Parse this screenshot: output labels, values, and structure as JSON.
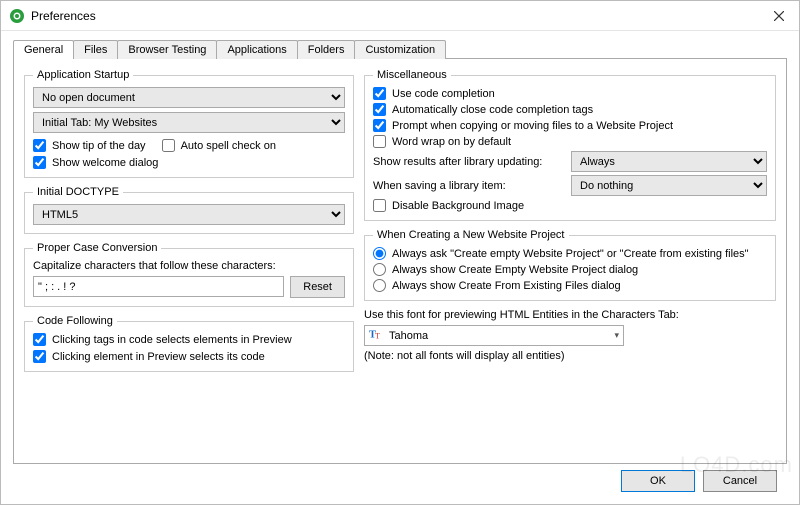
{
  "window": {
    "title": "Preferences"
  },
  "tabs": [
    "General",
    "Files",
    "Browser Testing",
    "Applications",
    "Folders",
    "Customization"
  ],
  "startup": {
    "legend": "Application Startup",
    "doc": "No open document",
    "initialTab": "Initial Tab: My Websites",
    "tip": "Show tip of the day",
    "spell": "Auto spell check on",
    "welcome": "Show welcome dialog"
  },
  "doctype": {
    "legend": "Initial DOCTYPE",
    "value": "HTML5"
  },
  "propercase": {
    "legend": "Proper Case Conversion",
    "label": "Capitalize characters that follow these characters:",
    "value": "\" ; : . ! ?",
    "reset": "Reset"
  },
  "codefollow": {
    "legend": "Code Following",
    "a": "Clicking tags in code selects elements in Preview",
    "b": "Clicking element in Preview selects its code"
  },
  "misc": {
    "legend": "Miscellaneous",
    "useCode": "Use code completion",
    "autoClose": "Automatically close code completion tags",
    "prompt": "Prompt when copying or moving files to a Website Project",
    "wrap": "Word wrap on by default",
    "resultsLabel": "Show results after library updating:",
    "resultsValue": "Always",
    "savingLabel": "When saving a library item:",
    "savingValue": "Do nothing",
    "disableBg": "Disable Background Image"
  },
  "newproj": {
    "legend": "When Creating a New Website Project",
    "r1": "Always ask \"Create empty Website Project\" or \"Create from existing files\"",
    "r2": "Always show Create Empty Website Project dialog",
    "r3": "Always show Create From Existing Files dialog"
  },
  "font": {
    "label": "Use this font for previewing HTML Entities in the Characters Tab:",
    "value": "Tahoma",
    "note": "(Note: not all fonts will display all entities)"
  },
  "footer": {
    "ok": "OK",
    "cancel": "Cancel"
  },
  "watermark": "LO4D.com"
}
